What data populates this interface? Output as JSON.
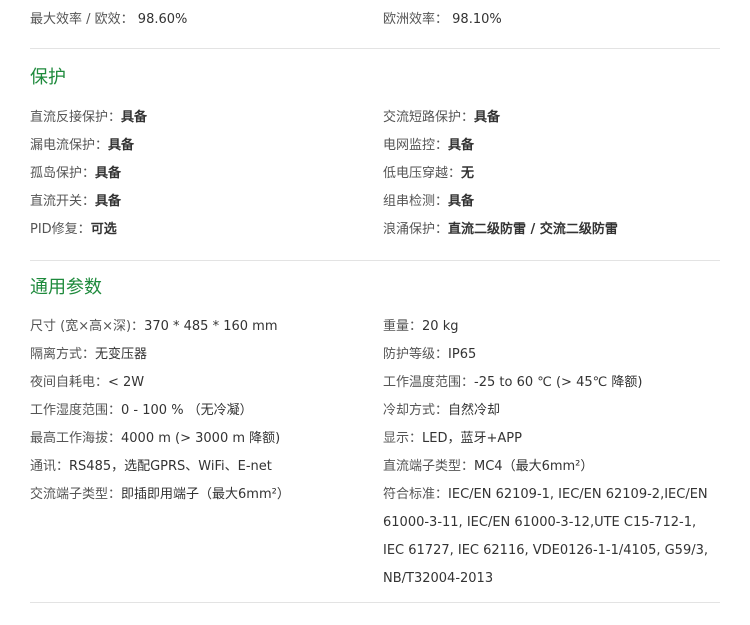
{
  "efficiency": {
    "max_label": "最大效率 / 欧效：",
    "max_value": "98.60%",
    "euro_label": "欧洲效率：",
    "euro_value": "98.10%"
  },
  "protection": {
    "title": "保护",
    "rows": [
      {
        "l_label": "直流反接保护：",
        "l_value": "具备",
        "r_label": "交流短路保护：",
        "r_value": "具备"
      },
      {
        "l_label": "漏电流保护：",
        "l_value": "具备",
        "r_label": "电网监控：",
        "r_value": "具备"
      },
      {
        "l_label": "孤岛保护：",
        "l_value": "具备",
        "r_label": "低电压穿越：",
        "r_value": "无"
      },
      {
        "l_label": "直流开关：",
        "l_value": "具备",
        "r_label": "组串检测：",
        "r_value": "具备"
      },
      {
        "l_label": "PID修复：",
        "l_value": "可选",
        "r_label": "浪涌保护：",
        "r_value": "直流二级防雷 / 交流二级防雷"
      }
    ]
  },
  "general": {
    "title": "通用参数",
    "rows": [
      {
        "l_label": "尺寸 (宽×高×深)：",
        "l_value": "370 * 485 * 160 mm",
        "r_label": "重量：",
        "r_value": "20 kg"
      },
      {
        "l_label": "隔离方式：",
        "l_value": "无变压器",
        "r_label": "防护等级：",
        "r_value": "IP65"
      },
      {
        "l_label": "夜间自耗电：",
        "l_value": "< 2W",
        "r_label": "工作温度范围：",
        "r_value": "-25 to 60 ℃ (> 45℃ 降额)"
      },
      {
        "l_label": "工作湿度范围：",
        "l_value": "0 - 100 % （无冷凝）",
        "r_label": "冷却方式：",
        "r_value": "自然冷却"
      },
      {
        "l_label": "最高工作海拔：",
        "l_value": "4000 m (> 3000 m 降额)",
        "r_label": "显示：",
        "r_value": "LED，蓝牙+APP"
      },
      {
        "l_label": "通讯：",
        "l_value": "RS485，选配GPRS、WiFi、E-net",
        "r_label": "直流端子类型：",
        "r_value": "MC4（最大6mm²）"
      }
    ],
    "last_left_label": "交流端子类型：",
    "last_left_value": "即插即用端子（最大6mm²）",
    "standards_label": "符合标准：",
    "standards_value": "IEC/EN 62109-1, IEC/EN 62109-2,IEC/EN 61000-3-11, IEC/EN 61000-3-12,UTE C15-712-1, IEC 61727, IEC 62116, VDE0126-1-1/4105, G59/3, NB/T32004-2013"
  }
}
